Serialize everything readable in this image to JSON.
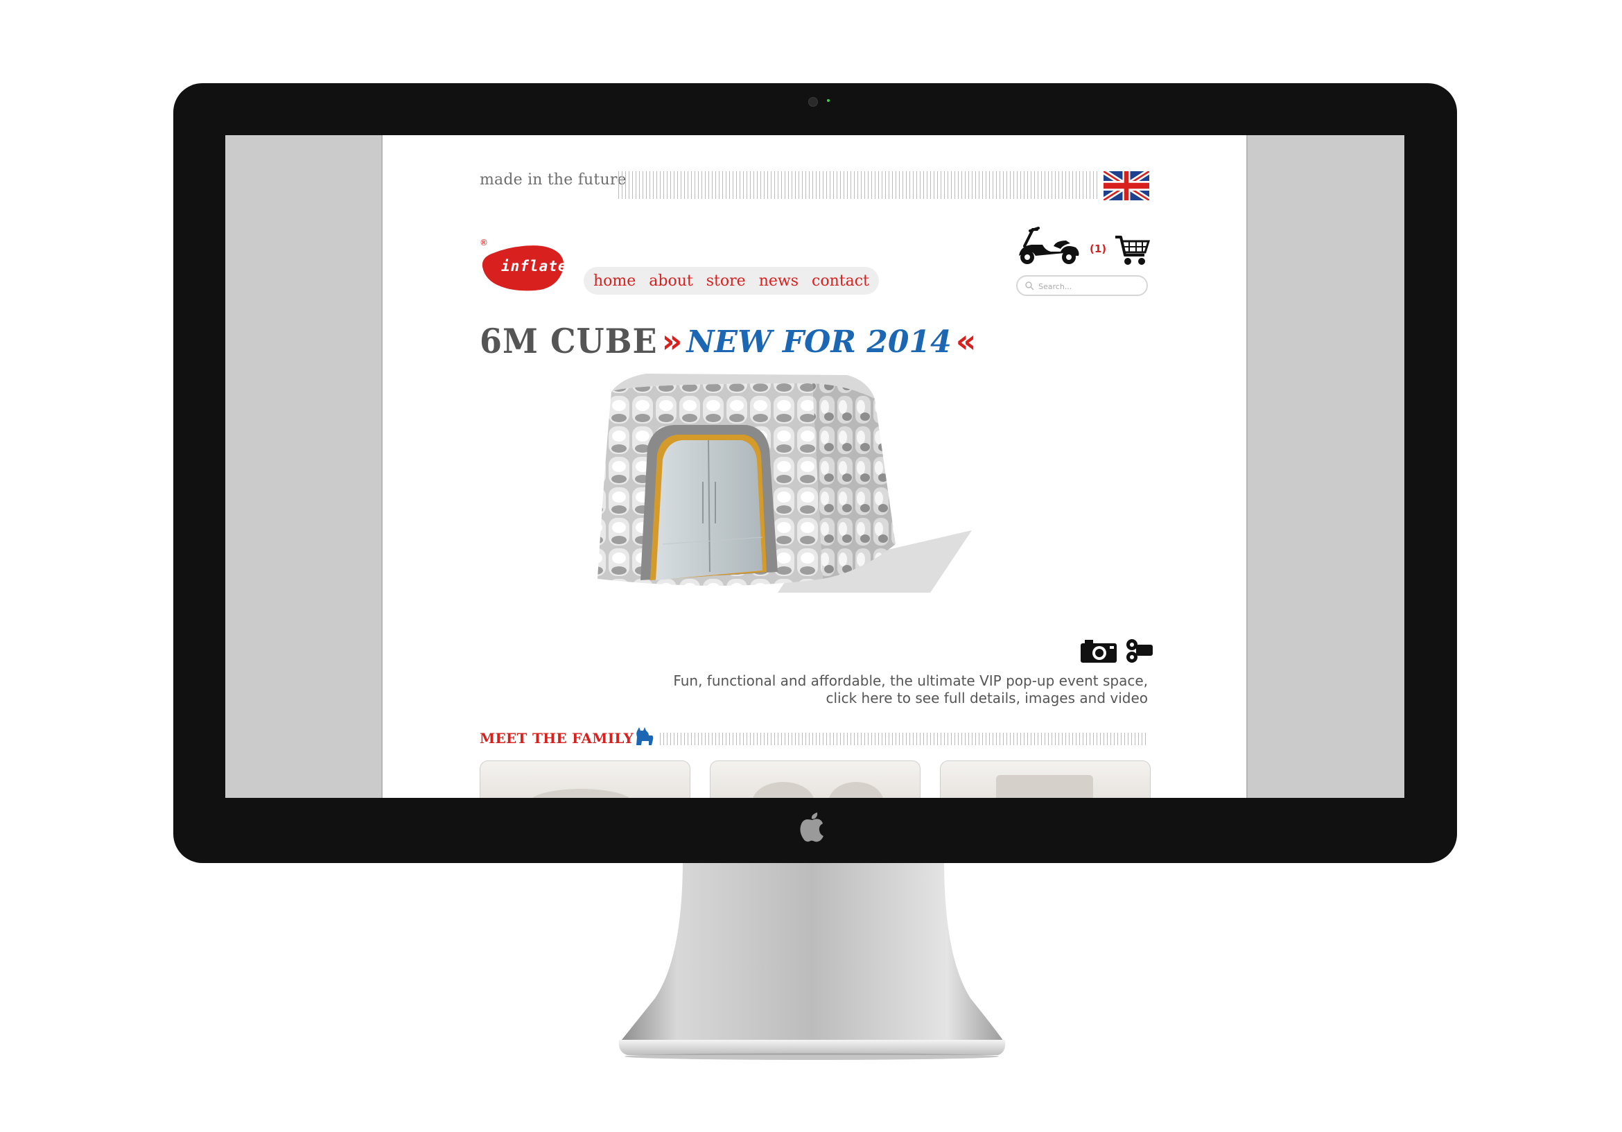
{
  "tagline": "made in the future",
  "logo": {
    "text": "inflate",
    "reg": "®"
  },
  "nav": [
    {
      "label": "home"
    },
    {
      "label": "about"
    },
    {
      "label": "store"
    },
    {
      "label": "news"
    },
    {
      "label": "contact"
    }
  ],
  "cart": {
    "count": "(1)"
  },
  "search": {
    "placeholder": "Search..."
  },
  "headline": {
    "product": "6M CUBE",
    "arrow_open": "»",
    "tagline": "NEW FOR 2014",
    "arrow_close": "«"
  },
  "description": {
    "line1": "Fun, functional and affordable, the ultimate VIP pop-up event space,",
    "line2": "click here to see full details, images and video"
  },
  "family": {
    "title": "MEET THE FAMILY"
  },
  "colors": {
    "brand_red": "#d8201e",
    "headline_blue": "#1c67b4",
    "headline_grey": "#555555",
    "screen_backdrop": "#cbcbcb",
    "bezel": "#111111"
  },
  "icons": [
    "uk-flag-icon",
    "scooter-icon",
    "cart-icon",
    "search-icon",
    "camera-icon",
    "video-camera-icon",
    "dog-icon",
    "apple-logo-icon"
  ]
}
